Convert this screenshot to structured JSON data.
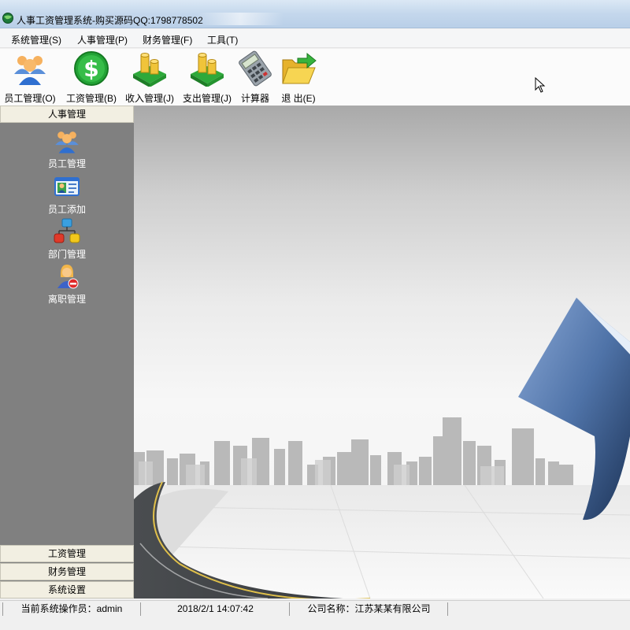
{
  "window": {
    "title": "人事工资管理系统-购买源码QQ:1798778502"
  },
  "menu": [
    {
      "label": "系统管理(S)"
    },
    {
      "label": "人事管理(P)"
    },
    {
      "label": "财务管理(F)"
    },
    {
      "label": "工具(T)"
    }
  ],
  "toolbar": [
    {
      "label": "员工管理(O)",
      "icon": "people-icon"
    },
    {
      "label": "工资管理(B)",
      "icon": "dollar-icon"
    },
    {
      "label": "收入管理(J)",
      "icon": "coins-icon"
    },
    {
      "label": "支出管理(J)",
      "icon": "coins-icon"
    },
    {
      "label": "计算器",
      "icon": "calculator-icon"
    },
    {
      "label": "退 出(E)",
      "icon": "exit-folder-icon"
    }
  ],
  "sidebar": {
    "active_group": "人事管理",
    "items": [
      {
        "label": "员工管理",
        "icon": "people-icon"
      },
      {
        "label": "员工添加",
        "icon": "id-card-icon"
      },
      {
        "label": "部门管理",
        "icon": "org-chart-icon"
      },
      {
        "label": "离职管理",
        "icon": "user-remove-icon"
      }
    ],
    "groups": [
      "工资管理",
      "财务管理",
      "系统设置"
    ]
  },
  "status": {
    "operator": "当前系统操作员：admin",
    "datetime": "2018/2/1 14:07:42",
    "company": "公司名称：江苏某某有限公司"
  },
  "colors": {
    "sidebar_bg": "#808080",
    "header_bg": "#f2efe2",
    "title_bar": "#c4d7ec"
  }
}
